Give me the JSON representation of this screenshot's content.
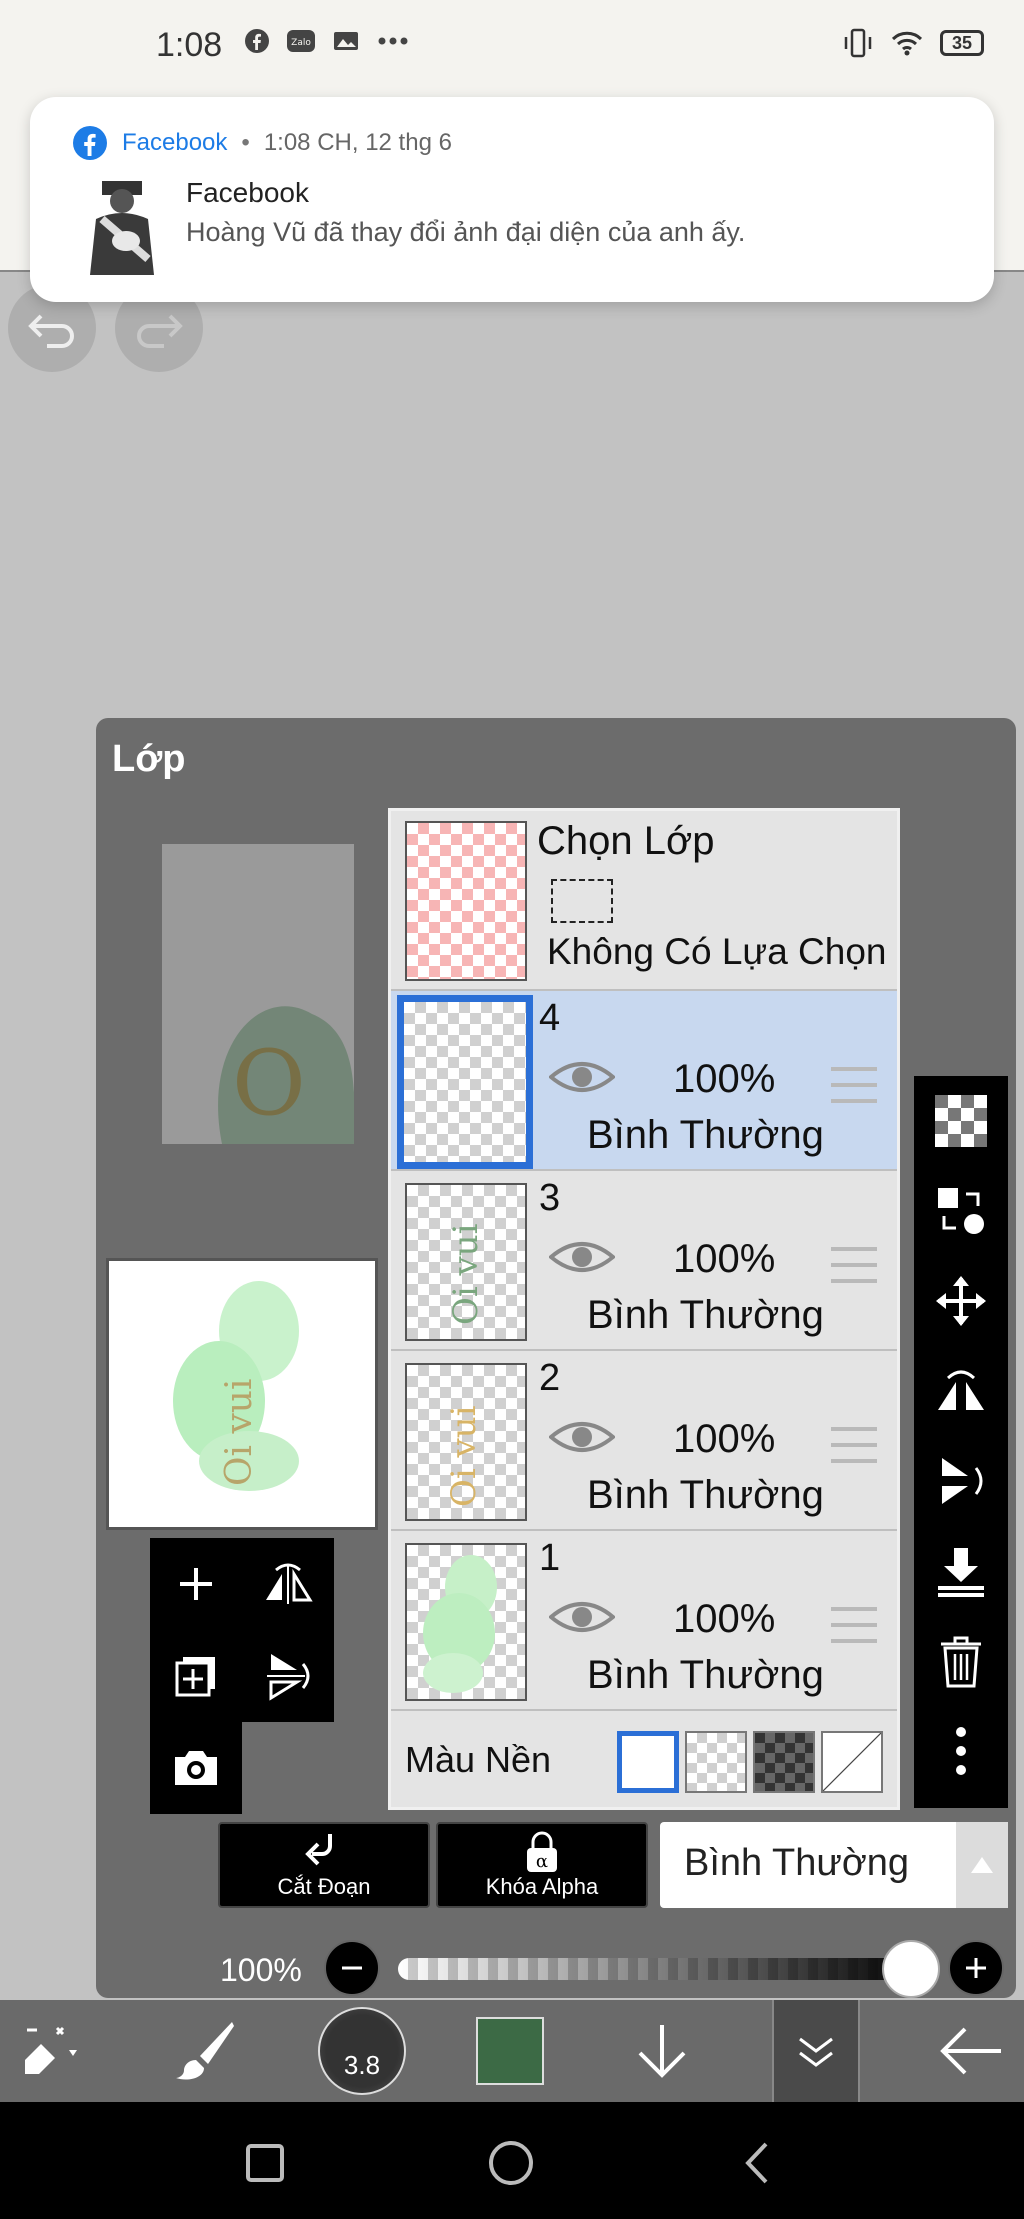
{
  "status_bar": {
    "time": "1:08",
    "battery": "35"
  },
  "notification": {
    "app_name": "Facebook",
    "separator": "•",
    "time": "1:08 CH, 12 thg 6",
    "title": "Facebook",
    "text": "Hoàng Vũ đã thay đổi ảnh đại diện của anh ấy."
  },
  "panel": {
    "title": "Lớp",
    "selection_layer": {
      "title": "Chọn Lớp",
      "subtitle": "Không Có Lựa Chọn"
    },
    "layers": [
      {
        "number": "4",
        "opacity": "100%",
        "blend": "Bình Thường",
        "selected": true
      },
      {
        "number": "3",
        "opacity": "100%",
        "blend": "Bình Thường",
        "selected": false
      },
      {
        "number": "2",
        "opacity": "100%",
        "blend": "Bình Thường",
        "selected": false
      },
      {
        "number": "1",
        "opacity": "100%",
        "blend": "Bình Thường",
        "selected": false
      }
    ],
    "background": {
      "label": "Màu Nền"
    },
    "cut_label": "Cắt Đoạn",
    "alpha_label": "Khóa Alpha",
    "blend_mode": "Bình Thường",
    "opacity_label": "100%",
    "opacity_value": 1.0
  },
  "toolbar": {
    "brush_size": "3.8",
    "color": "#3c6a45"
  },
  "colors": {
    "selected_layer": "#c8d8ef",
    "accent": "#2b6fd6",
    "facebook": "#1d7ce6"
  }
}
